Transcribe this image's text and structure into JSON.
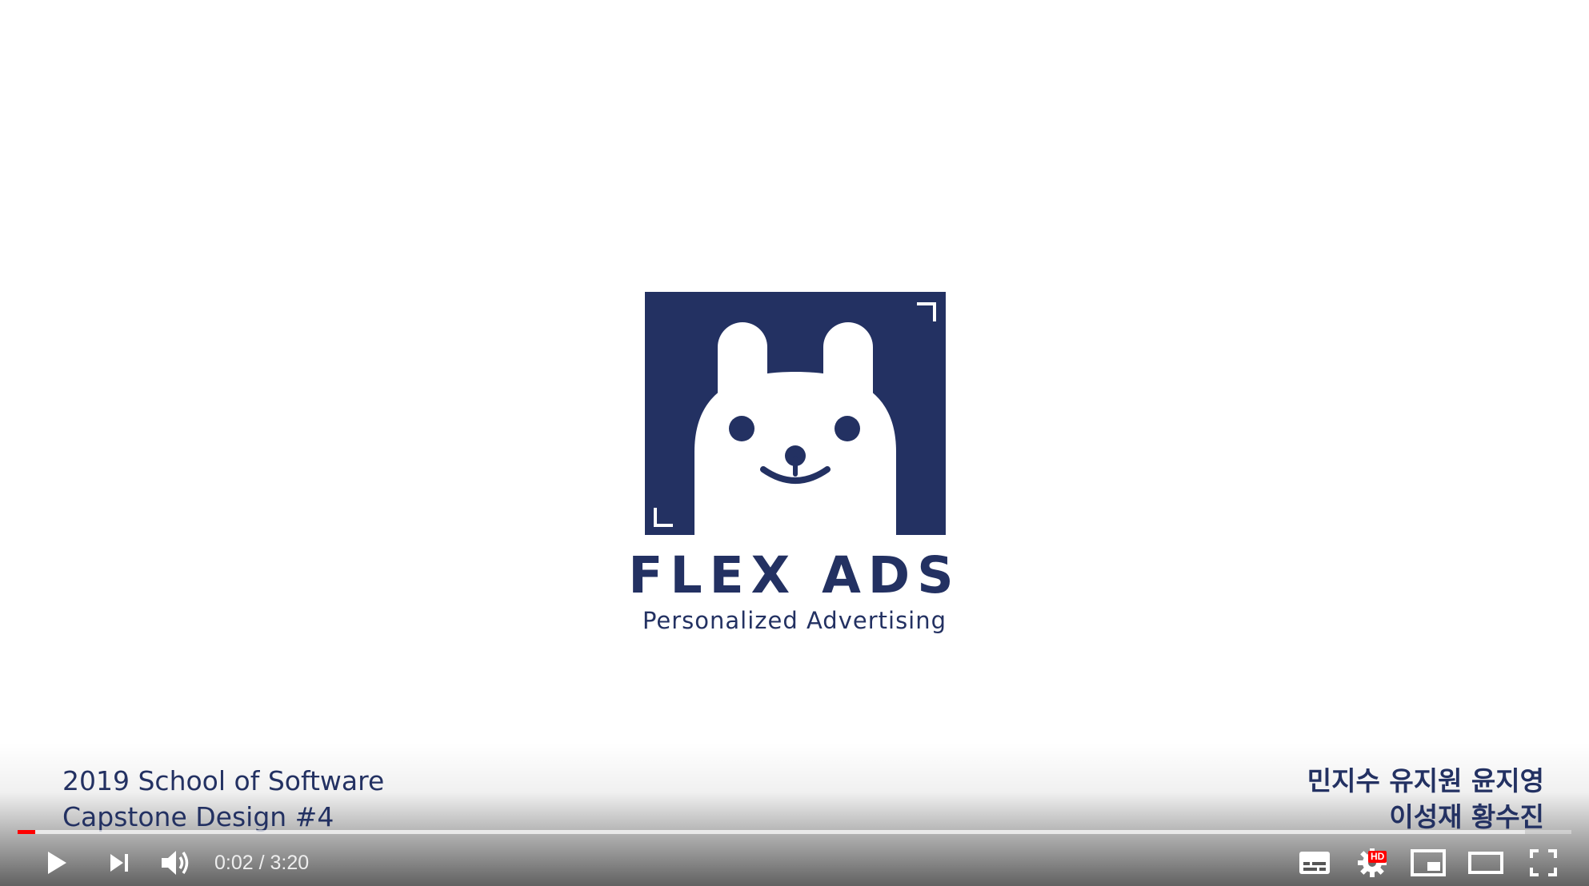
{
  "logo": {
    "title": "FLEX ADS",
    "subtitle": "Personalized Advertising",
    "brand_color": "#233162"
  },
  "captions": {
    "left": [
      "2019 School of Software",
      "Capstone Design #4"
    ],
    "right": [
      "민지수 유지원 윤지영",
      "이성재 황수진"
    ]
  },
  "player": {
    "current_time": "0:02",
    "separator": " / ",
    "duration": "3:20",
    "progress_fraction": 0.01,
    "quality_badge": "HD",
    "accent_color": "#ff0000",
    "icons": {
      "play": "play-icon",
      "next": "next-icon",
      "volume": "volume-icon",
      "subtitles": "subtitles-icon",
      "settings": "gear-icon",
      "miniplayer": "miniplayer-icon",
      "theater": "theater-icon",
      "fullscreen": "fullscreen-icon"
    }
  }
}
